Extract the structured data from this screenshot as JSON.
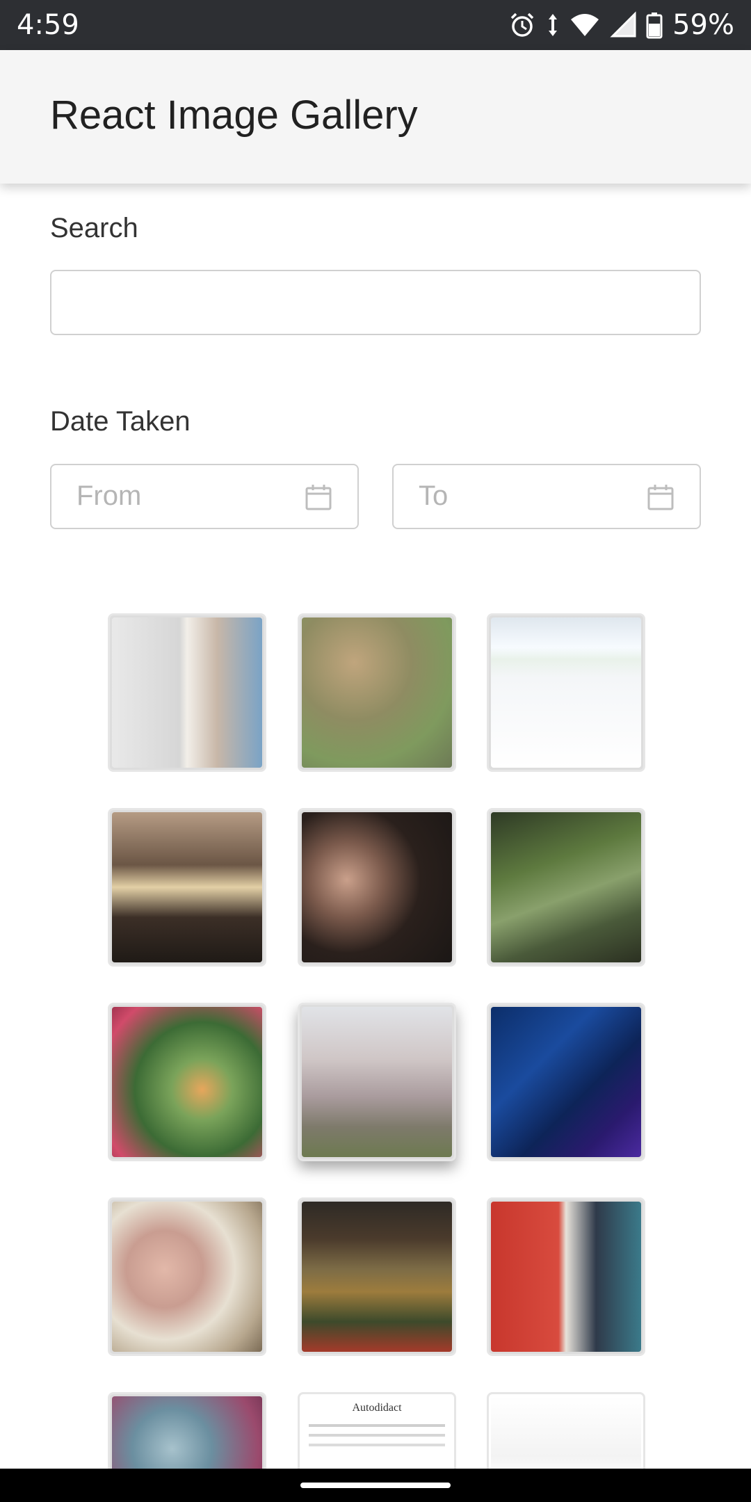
{
  "status_bar": {
    "time": "4:59",
    "battery_percent": "59%",
    "icons": [
      "alarm-icon",
      "data-arrows-icon",
      "wifi-icon",
      "signal-icon",
      "battery-icon"
    ]
  },
  "app_bar": {
    "title": "React Image Gallery"
  },
  "search": {
    "label": "Search",
    "value": "",
    "placeholder": ""
  },
  "date_taken": {
    "label": "Date Taken",
    "from_placeholder": "From",
    "to_placeholder": "To"
  },
  "gallery": {
    "selected_index": 7,
    "images": [
      {
        "kind": "photo",
        "subject": "child-portrait-collage"
      },
      {
        "kind": "photo",
        "subject": "goldfinch"
      },
      {
        "kind": "screenshot",
        "subject": "chat-messages"
      },
      {
        "kind": "photo",
        "subject": "sunset-clouds"
      },
      {
        "kind": "photo",
        "subject": "couple-selfie"
      },
      {
        "kind": "photo",
        "subject": "forest-stream"
      },
      {
        "kind": "photo",
        "subject": "persimmon-tree"
      },
      {
        "kind": "photo",
        "subject": "blossom-trees"
      },
      {
        "kind": "graphic",
        "subject": "infographic-blue"
      },
      {
        "kind": "photo",
        "subject": "sleeping-baby"
      },
      {
        "kind": "photo",
        "subject": "porch-plants"
      },
      {
        "kind": "photo",
        "subject": "cooking-kitchen"
      },
      {
        "kind": "photo",
        "subject": "blurred-color"
      },
      {
        "kind": "document",
        "subject": "document-page",
        "title": "Autodidact"
      },
      {
        "kind": "graphic",
        "subject": "product-ad"
      }
    ]
  },
  "colors": {
    "status_bar_bg": "#2d2f33",
    "app_bar_bg": "#f5f5f5",
    "border": "#d0d0d0",
    "placeholder": "#b5b5b5"
  }
}
